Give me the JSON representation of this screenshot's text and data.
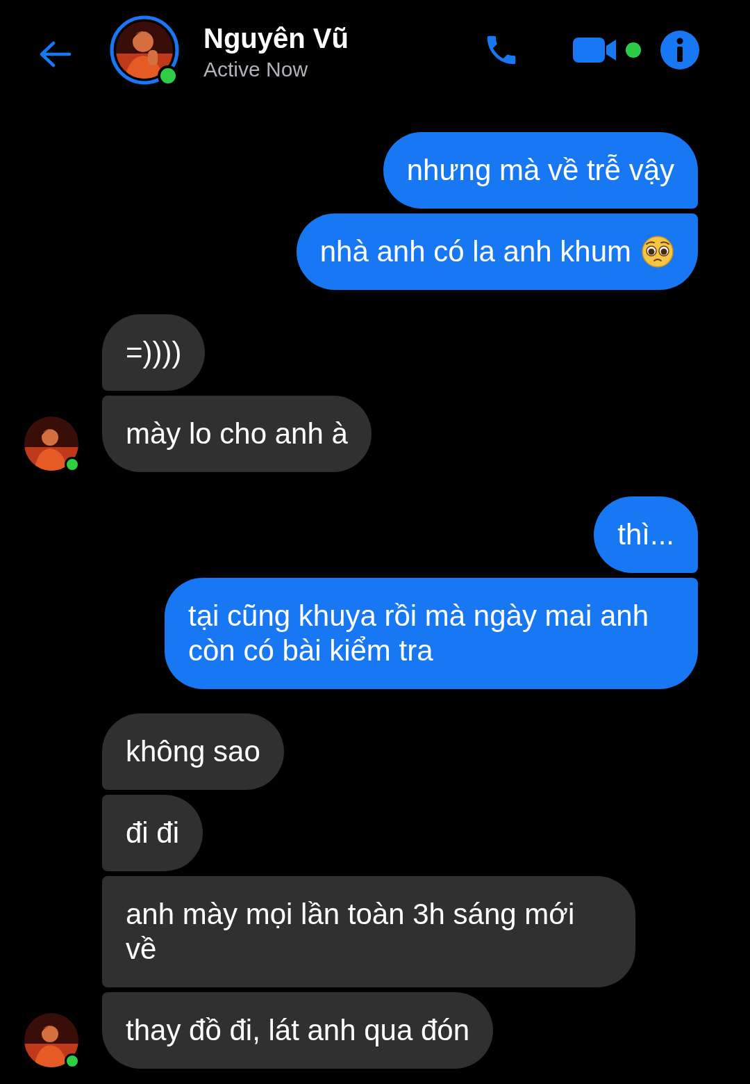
{
  "header": {
    "name": "Nguyên Vũ",
    "status": "Active Now",
    "online": true,
    "video_active": true
  },
  "messages": [
    {
      "kind": "sent",
      "text": "nhưng mà về trễ vậy"
    },
    {
      "kind": "sent",
      "text": "nhà anh có la anh khum",
      "pleading_emoji": true
    },
    {
      "kind": "received",
      "text": "=))))"
    },
    {
      "kind": "received",
      "text": "mày lo cho anh à",
      "avatar": true,
      "online": true
    },
    {
      "kind": "sent",
      "text": "thì..."
    },
    {
      "kind": "sent",
      "text": "tại cũng khuya rồi mà ngày mai anh còn có bài kiểm tra"
    },
    {
      "kind": "received",
      "text": "không sao"
    },
    {
      "kind": "received",
      "text": "đi đi"
    },
    {
      "kind": "received",
      "text": "anh mày mọi lần toàn 3h sáng mới về"
    },
    {
      "kind": "received",
      "text": "thay đồ đi, lát anh qua đón",
      "avatar": true,
      "online": true
    }
  ]
}
